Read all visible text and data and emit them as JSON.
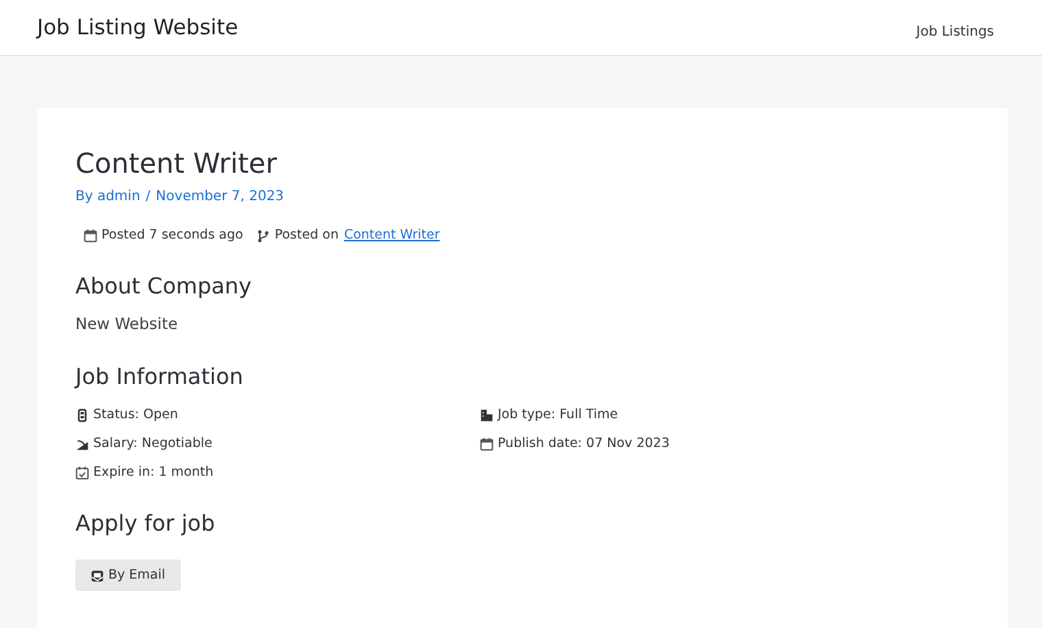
{
  "site": {
    "title": "Job Listing Website",
    "nav": [
      {
        "label": "Job Listings"
      }
    ]
  },
  "post": {
    "title": "Content Writer",
    "author": "By admin",
    "separator": "/",
    "date": "November 7, 2023",
    "posted": "Posted 7 seconds ago",
    "posted_on": "Posted on",
    "category": "Content Writer"
  },
  "about": {
    "heading": "About Company",
    "text": "New Website"
  },
  "job_info": {
    "heading": "Job Information",
    "items": [
      {
        "kind": "status",
        "text": "Status: Open"
      },
      {
        "kind": "jobtype",
        "text": "Job type: Full Time"
      },
      {
        "kind": "salary",
        "text": "Salary: Negotiable"
      },
      {
        "kind": "calendar",
        "text": "Publish date: 07 Nov 2023"
      },
      {
        "kind": "expire",
        "text": "Expire in: 1 month"
      }
    ]
  },
  "apply": {
    "heading": "Apply for job",
    "button": "By Email"
  }
}
